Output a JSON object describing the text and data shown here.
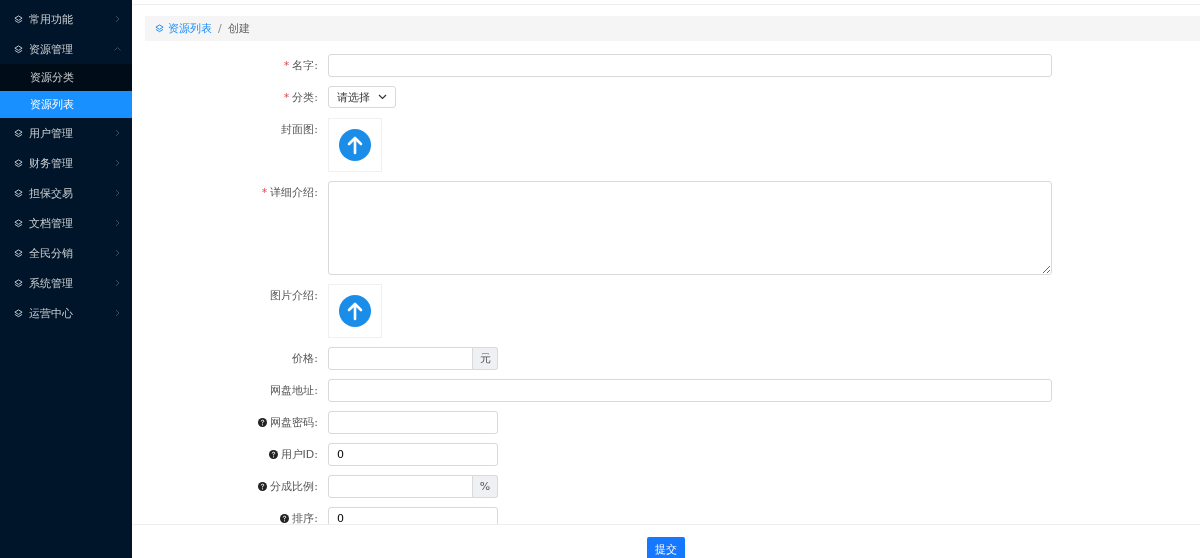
{
  "sidebar": {
    "items": [
      {
        "label": "常用功能",
        "expanded": false
      },
      {
        "label": "资源管理",
        "expanded": true,
        "children": [
          {
            "label": "资源分类",
            "selected": false
          },
          {
            "label": "资源列表",
            "selected": true
          }
        ]
      },
      {
        "label": "用户管理",
        "expanded": false
      },
      {
        "label": "财务管理",
        "expanded": false
      },
      {
        "label": "担保交易",
        "expanded": false
      },
      {
        "label": "文档管理",
        "expanded": false
      },
      {
        "label": "全民分销",
        "expanded": false
      },
      {
        "label": "系统管理",
        "expanded": false
      },
      {
        "label": "运营中心",
        "expanded": false
      }
    ]
  },
  "breadcrumb": {
    "link": "资源列表",
    "separator": "/",
    "current": "创建"
  },
  "form": {
    "fields": [
      {
        "kind": "wide-input",
        "label": "名字:",
        "required_mark": "*",
        "help": false
      },
      {
        "kind": "select",
        "label": "分类:",
        "required_mark": "*",
        "help": false,
        "placeholder": "请选择"
      },
      {
        "kind": "upload",
        "label": "封面图:",
        "help": false
      },
      {
        "kind": "textarea",
        "label": "详细介绍:",
        "required_mark": "*",
        "help": false
      },
      {
        "kind": "upload",
        "label": "图片介绍:",
        "help": false
      },
      {
        "kind": "addon-input",
        "label": "价格:",
        "help": false,
        "addon": "元"
      },
      {
        "kind": "wide-input",
        "label": "网盘地址:",
        "help": false
      },
      {
        "kind": "input",
        "label": "网盘密码:",
        "help": true
      },
      {
        "kind": "input",
        "label": "用户ID:",
        "help": true,
        "value": "0"
      },
      {
        "kind": "addon-input",
        "label": "分成比例:",
        "help": true,
        "addon": "%"
      },
      {
        "kind": "input",
        "label": "排序:",
        "help": true,
        "value": "0"
      }
    ]
  },
  "submit": "提交"
}
